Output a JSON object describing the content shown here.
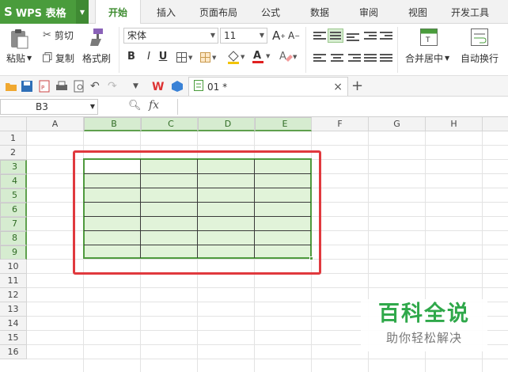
{
  "app": {
    "name": "WPS 表格",
    "logo": "S"
  },
  "menu_tabs": [
    "开始",
    "插入",
    "页面布局",
    "公式",
    "数据",
    "审阅",
    "视图",
    "开发工具"
  ],
  "active_tab": "开始",
  "ribbon": {
    "paste": "粘贴",
    "cut": "剪切",
    "copy": "复制",
    "format_painter": "格式刷",
    "font_name": "宋体",
    "font_size": "11",
    "bold": "B",
    "italic": "I",
    "underline": "U",
    "merge_center": "合并居中",
    "wrap_text": "自动换行"
  },
  "document": {
    "tab_title": "01 *",
    "close": "×",
    "new_tab": "+"
  },
  "formula_bar": {
    "name_box": "B3",
    "fx": "fx"
  },
  "columns": [
    "A",
    "B",
    "C",
    "D",
    "E",
    "F",
    "G",
    "H"
  ],
  "rows": [
    "1",
    "2",
    "3",
    "4",
    "5",
    "6",
    "7",
    "8",
    "9",
    "10",
    "11",
    "12",
    "13",
    "14",
    "15",
    "16"
  ],
  "selection": {
    "active_cell": "B3",
    "range": "B3:E9"
  },
  "watermark": {
    "title": "百科全说",
    "subtitle": "助你轻松解决"
  },
  "colors": {
    "wps_green": "#4a9c3c",
    "selection_fill": "#e1f3d9",
    "selection_border": "#4f9a3e",
    "highlight_red": "#e0393e",
    "watermark_green": "#2fa84a"
  }
}
